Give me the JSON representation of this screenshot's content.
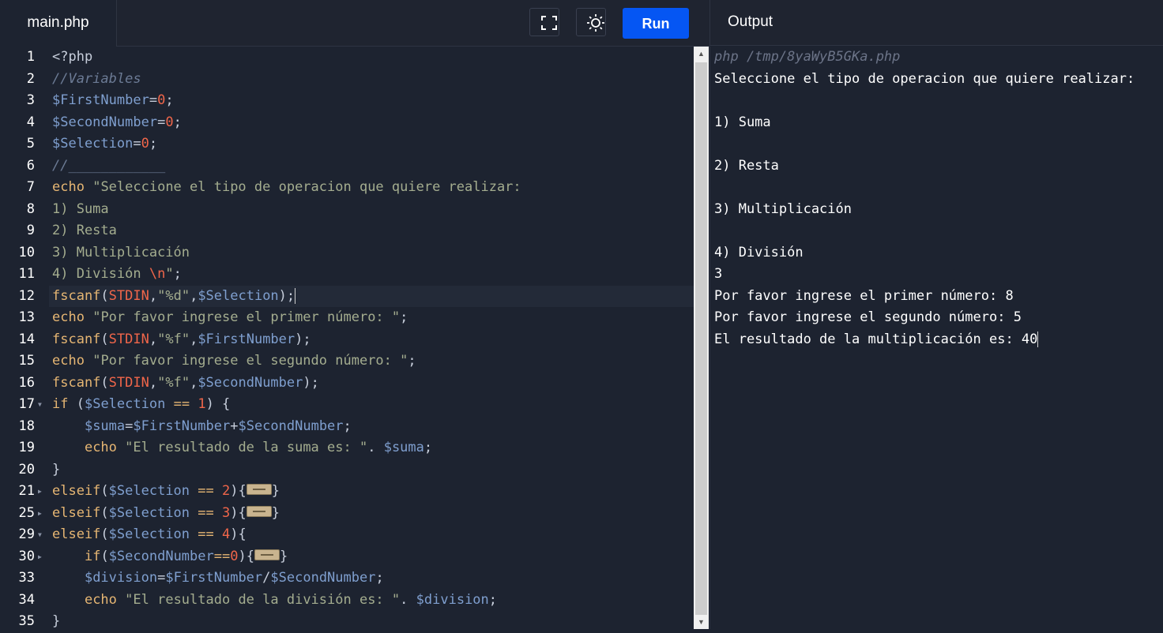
{
  "header": {
    "file_tab": "main.php",
    "run_label": "Run",
    "fullscreen_icon": "fullscreen-icon",
    "theme_icon": "sun-icon"
  },
  "output_panel": {
    "title": "Output",
    "lines": [
      "php /tmp/8yaWyB5GKa.php",
      "Seleccione el tipo de operacion que quiere realizar:",
      "",
      "1) Suma",
      "",
      "2) Resta",
      "",
      "3) Multiplicación",
      "",
      "4) División",
      "3",
      "Por favor ingrese el primer número: 8",
      "Por favor ingrese el segundo número: 5",
      "El resultado de la multiplicación es: 40"
    ]
  },
  "editor": {
    "line_numbers": [
      "1",
      "2",
      "3",
      "4",
      "5",
      "6",
      "7",
      "8",
      "9",
      "10",
      "11",
      "12",
      "13",
      "14",
      "15",
      "16",
      "17",
      "18",
      "19",
      "20",
      "21",
      "25",
      "29",
      "30",
      "33",
      "34",
      "35"
    ],
    "fold_markers": {
      "17": "open",
      "21": "closed",
      "25": "closed",
      "29": "open",
      "30": "closed"
    },
    "active_line_index": 11,
    "lines": [
      [
        [
          "p",
          "<?php"
        ]
      ],
      [
        [
          "c",
          "//Variables"
        ]
      ],
      [
        [
          "v",
          "$FirstNumber"
        ],
        [
          "p",
          "="
        ],
        [
          "n",
          "0"
        ],
        [
          "p",
          ";"
        ]
      ],
      [
        [
          "v",
          "$SecondNumber"
        ],
        [
          "p",
          "="
        ],
        [
          "n",
          "0"
        ],
        [
          "p",
          ";"
        ]
      ],
      [
        [
          "v",
          "$Selection"
        ],
        [
          "p",
          "="
        ],
        [
          "n",
          "0"
        ],
        [
          "p",
          ";"
        ]
      ],
      [
        [
          "c",
          "//____________"
        ]
      ],
      [
        [
          "k",
          "echo"
        ],
        [
          "p",
          " "
        ],
        [
          "s",
          "\"Seleccione el tipo de operacion que quiere realizar:"
        ]
      ],
      [
        [
          "s",
          "1) Suma"
        ]
      ],
      [
        [
          "s",
          "2) Resta"
        ]
      ],
      [
        [
          "s",
          "3) Multiplicación"
        ]
      ],
      [
        [
          "s",
          "4) División "
        ],
        [
          "n",
          "\\n"
        ],
        [
          "s",
          "\""
        ],
        [
          "p",
          ";"
        ]
      ],
      [
        [
          "k",
          "fscanf"
        ],
        [
          "p",
          "("
        ],
        [
          "n",
          "STDIN"
        ],
        [
          "p",
          ","
        ],
        [
          "s",
          "\"%d\""
        ],
        [
          "p",
          ","
        ],
        [
          "v",
          "$Selection"
        ],
        [
          "p",
          ");"
        ]
      ],
      [
        [
          "k",
          "echo"
        ],
        [
          "p",
          " "
        ],
        [
          "s",
          "\"Por favor ingrese el primer número: \""
        ],
        [
          "p",
          ";"
        ]
      ],
      [
        [
          "k",
          "fscanf"
        ],
        [
          "p",
          "("
        ],
        [
          "n",
          "STDIN"
        ],
        [
          "p",
          ","
        ],
        [
          "s",
          "\"%f\""
        ],
        [
          "p",
          ","
        ],
        [
          "v",
          "$FirstNumber"
        ],
        [
          "p",
          ");"
        ]
      ],
      [
        [
          "k",
          "echo"
        ],
        [
          "p",
          " "
        ],
        [
          "s",
          "\"Por favor ingrese el segundo número: \""
        ],
        [
          "p",
          ";"
        ]
      ],
      [
        [
          "k",
          "fscanf"
        ],
        [
          "p",
          "("
        ],
        [
          "n",
          "STDIN"
        ],
        [
          "p",
          ","
        ],
        [
          "s",
          "\"%f\""
        ],
        [
          "p",
          ","
        ],
        [
          "v",
          "$SecondNumber"
        ],
        [
          "p",
          ");"
        ]
      ],
      [
        [
          "k",
          "if"
        ],
        [
          "p",
          " ("
        ],
        [
          "v",
          "$Selection"
        ],
        [
          "p",
          " "
        ],
        [
          "k",
          "=="
        ],
        [
          "p",
          " "
        ],
        [
          "n",
          "1"
        ],
        [
          "p",
          ") {"
        ]
      ],
      [
        [
          "p",
          "    "
        ],
        [
          "v",
          "$suma"
        ],
        [
          "p",
          "="
        ],
        [
          "v",
          "$FirstNumber"
        ],
        [
          "p",
          "+"
        ],
        [
          "v",
          "$SecondNumber"
        ],
        [
          "p",
          ";"
        ]
      ],
      [
        [
          "p",
          "    "
        ],
        [
          "k",
          "echo"
        ],
        [
          "p",
          " "
        ],
        [
          "s",
          "\"El resultado de la suma es: \""
        ],
        [
          "p",
          "."
        ],
        [
          "p",
          " "
        ],
        [
          "v",
          "$suma"
        ],
        [
          "p",
          ";"
        ]
      ],
      [
        [
          "p",
          "}"
        ]
      ],
      [
        [
          "k",
          "elseif"
        ],
        [
          "p",
          "("
        ],
        [
          "v",
          "$Selection"
        ],
        [
          "p",
          " "
        ],
        [
          "k",
          "=="
        ],
        [
          "p",
          " "
        ],
        [
          "n",
          "2"
        ],
        [
          "p",
          ")"
        ],
        [
          "p",
          "{"
        ],
        [
          "fold",
          ""
        ],
        [
          "p",
          "}"
        ]
      ],
      [
        [
          "k",
          "elseif"
        ],
        [
          "p",
          "("
        ],
        [
          "v",
          "$Selection"
        ],
        [
          "p",
          " "
        ],
        [
          "k",
          "=="
        ],
        [
          "p",
          " "
        ],
        [
          "n",
          "3"
        ],
        [
          "p",
          ")"
        ],
        [
          "p",
          "{"
        ],
        [
          "fold",
          ""
        ],
        [
          "p",
          "}"
        ]
      ],
      [
        [
          "k",
          "elseif"
        ],
        [
          "p",
          "("
        ],
        [
          "v",
          "$Selection"
        ],
        [
          "p",
          " "
        ],
        [
          "k",
          "=="
        ],
        [
          "p",
          " "
        ],
        [
          "n",
          "4"
        ],
        [
          "p",
          "){"
        ]
      ],
      [
        [
          "p",
          "    "
        ],
        [
          "k",
          "if"
        ],
        [
          "p",
          "("
        ],
        [
          "v",
          "$SecondNumber"
        ],
        [
          "k",
          "=="
        ],
        [
          "n",
          "0"
        ],
        [
          "p",
          "){"
        ],
        [
          "fold",
          ""
        ],
        [
          "p",
          "}"
        ]
      ],
      [
        [
          "p",
          "    "
        ],
        [
          "v",
          "$division"
        ],
        [
          "p",
          "="
        ],
        [
          "v",
          "$FirstNumber"
        ],
        [
          "p",
          "/"
        ],
        [
          "v",
          "$SecondNumber"
        ],
        [
          "p",
          ";"
        ]
      ],
      [
        [
          "p",
          "    "
        ],
        [
          "k",
          "echo"
        ],
        [
          "p",
          " "
        ],
        [
          "s",
          "\"El resultado de la división es: \""
        ],
        [
          "p",
          "."
        ],
        [
          "p",
          " "
        ],
        [
          "v",
          "$division"
        ],
        [
          "p",
          ";"
        ]
      ],
      [
        [
          "p",
          "}"
        ]
      ]
    ]
  }
}
